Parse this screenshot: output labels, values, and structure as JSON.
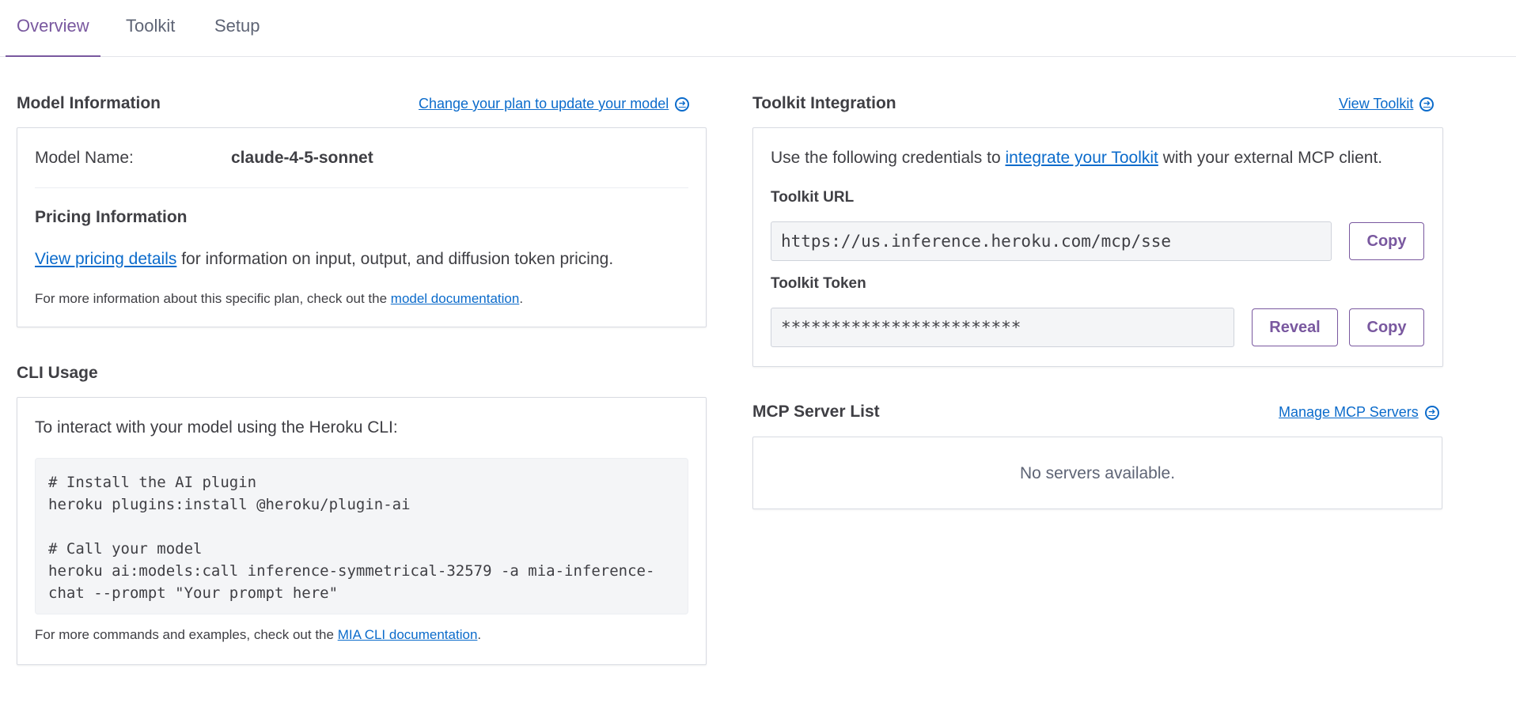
{
  "tabs": [
    {
      "label": "Overview",
      "active": true
    },
    {
      "label": "Toolkit",
      "active": false
    },
    {
      "label": "Setup",
      "active": false
    }
  ],
  "model_info": {
    "title": "Model Information",
    "change_plan_link": "Change your plan to update your model",
    "model_name_label": "Model Name:",
    "model_name_value": "claude-4-5-sonnet",
    "pricing_title": "Pricing Information",
    "pricing_link": "View pricing details",
    "pricing_text": " for information on input, output, and diffusion token pricing.",
    "plan_note_prefix": "For more information about this specific plan, check out the ",
    "plan_note_link": "model documentation",
    "plan_note_suffix": "."
  },
  "cli": {
    "title": "CLI Usage",
    "intro": "To interact with your model using the Heroku CLI:",
    "code": "# Install the AI plugin\nheroku plugins:install @heroku/plugin-ai\n\n# Call your model\nheroku ai:models:call inference-symmetrical-32579 -a mia-inference-\nchat --prompt \"Your prompt here\"",
    "note_prefix": "For more commands and examples, check out the ",
    "note_link": "MIA CLI documentation",
    "note_suffix": "."
  },
  "toolkit": {
    "title": "Toolkit Integration",
    "view_link": "View Toolkit",
    "intro_prefix": "Use the following credentials to ",
    "intro_link": "integrate your Toolkit",
    "intro_suffix": " with your external MCP client.",
    "url_label": "Toolkit URL",
    "url_value": "https://us.inference.heroku.com/mcp/sse",
    "token_label": "Toolkit Token",
    "token_value": "************************",
    "copy_label": "Copy",
    "reveal_label": "Reveal"
  },
  "mcp": {
    "title": "MCP Server List",
    "manage_link": "Manage MCP Servers",
    "empty_text": "No servers available."
  },
  "colors": {
    "accent": "#79589f",
    "link": "#0b6bcb"
  }
}
